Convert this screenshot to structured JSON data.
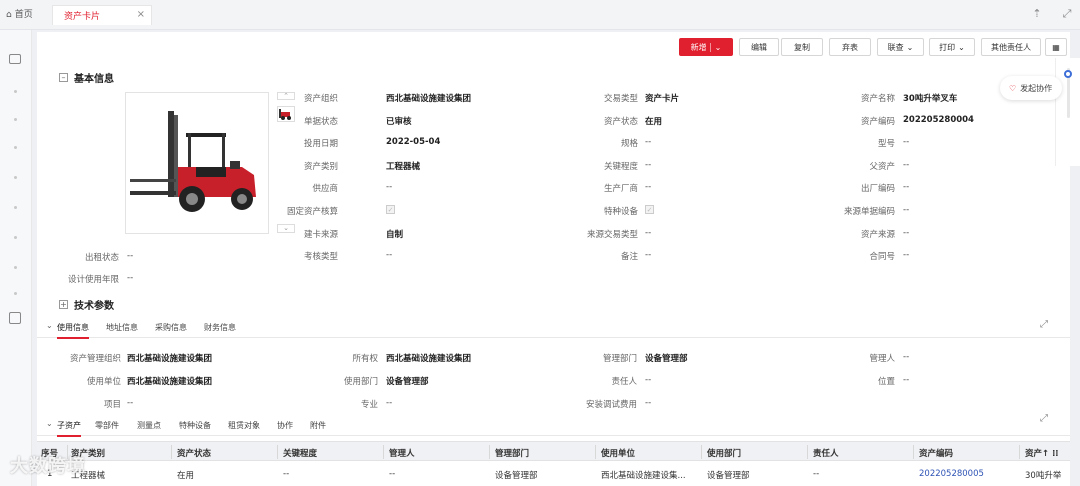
{
  "tabs": {
    "home": "首页",
    "active": "资产卡片"
  },
  "toolbar": {
    "new": "新增",
    "edit": "编辑",
    "copy": "复制",
    "discard": "弃表",
    "query": "联查",
    "print": "打印",
    "other": "其他责任人"
  },
  "flow_label": "发起协作",
  "basic": {
    "title": "基本信息",
    "fields": [
      {
        "l": "资产组织",
        "v": "西北基础设施建设集团"
      },
      {
        "l": "交易类型",
        "v": "资产卡片"
      },
      {
        "l": "资产名称",
        "v": "30吨升举叉车"
      },
      {
        "l": "单据状态",
        "v": "已审核"
      },
      {
        "l": "资产状态",
        "v": "在用"
      },
      {
        "l": "资产编码",
        "v": "202205280004"
      },
      {
        "l": "投用日期",
        "v": "2022-05-04"
      },
      {
        "l": "规格",
        "v": "--"
      },
      {
        "l": "型号",
        "v": "--"
      },
      {
        "l": "资产类别",
        "v": "工程器械"
      },
      {
        "l": "关键程度",
        "v": "--"
      },
      {
        "l": "父资产",
        "v": "--"
      },
      {
        "l": "供应商",
        "v": "--"
      },
      {
        "l": "生产厂商",
        "v": "--"
      },
      {
        "l": "出厂编码",
        "v": "--"
      },
      {
        "l": "固定资产核算",
        "v": ""
      },
      {
        "l": "特种设备",
        "v": ""
      },
      {
        "l": "来源单据编码",
        "v": "--"
      },
      {
        "l": "建卡来源",
        "v": "自制"
      },
      {
        "l": "来源交易类型",
        "v": "--"
      },
      {
        "l": "资产来源",
        "v": "--"
      },
      {
        "l": "考核类型",
        "v": "--"
      },
      {
        "l": "备注",
        "v": "--"
      },
      {
        "l": "合同号",
        "v": "--"
      }
    ],
    "rent_label": "出租状态",
    "rent_value": "--",
    "life_label": "设计使用年限",
    "life_value": "--"
  },
  "tech": {
    "title": "技术参数"
  },
  "usage_tabs": [
    "使用信息",
    "地址信息",
    "采购信息",
    "财务信息"
  ],
  "usage": [
    {
      "l": "资产管理组织",
      "v": "西北基础设施建设集团"
    },
    {
      "l": "所有权",
      "v": "西北基础设施建设集团"
    },
    {
      "l": "管理部门",
      "v": "设备管理部"
    },
    {
      "l": "管理人",
      "v": "--"
    },
    {
      "l": "使用单位",
      "v": "西北基础设施建设集团"
    },
    {
      "l": "使用部门",
      "v": "设备管理部"
    },
    {
      "l": "责任人",
      "v": "--"
    },
    {
      "l": "位置",
      "v": "--"
    },
    {
      "l": "项目",
      "v": "--"
    },
    {
      "l": "专业",
      "v": "--"
    },
    {
      "l": "安装调试费用",
      "v": "--"
    }
  ],
  "sub_tabs": [
    "子资产",
    "零部件",
    "测量点",
    "特种设备",
    "租赁对象",
    "协作",
    "附件"
  ],
  "table": {
    "headers": [
      "序号",
      "资产类别",
      "资产状态",
      "关键程度",
      "管理人",
      "管理部门",
      "使用单位",
      "使用部门",
      "责任人",
      "资产编码",
      "资产↑ ⁞⁞"
    ],
    "rows": [
      [
        "1",
        "工程器械",
        "在用",
        "--",
        "--",
        "设备管理部",
        "西北基础设施建设集...",
        "设备管理部",
        "--",
        "202205280005",
        "30吨升举"
      ]
    ]
  },
  "watermark": "大数跨境",
  "colors": {
    "accent": "#e0202e",
    "link": "#2f54b5"
  }
}
